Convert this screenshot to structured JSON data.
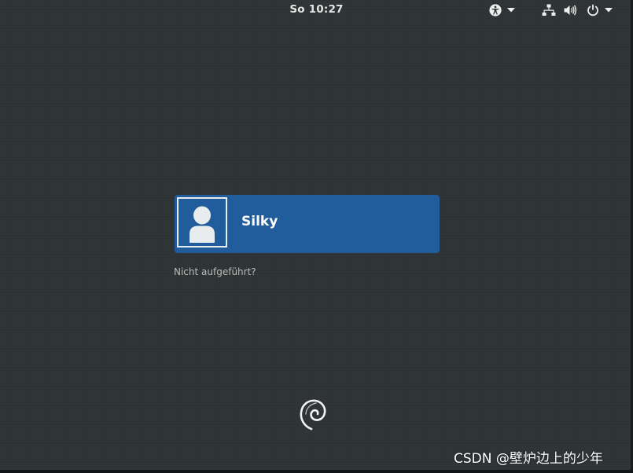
{
  "topbar": {
    "clock": "So 10:27",
    "icons": {
      "accessibility": "accessibility-icon",
      "network": "network-icon",
      "volume": "volume-icon",
      "power": "power-icon",
      "dropdown": "chevron-down-icon"
    }
  },
  "login": {
    "user_name": "Silky",
    "avatar_icon": "user-avatar-icon",
    "not_listed_link": "Nicht aufgeführt?"
  },
  "branding": {
    "logo_icon": "debian-swirl-icon",
    "watermark": "CSDN @壁炉边上的少年"
  },
  "colors": {
    "background": "#2e3436",
    "user_card": "#215d9c",
    "text": "#eeeeec",
    "link_text": "#babdb6"
  }
}
